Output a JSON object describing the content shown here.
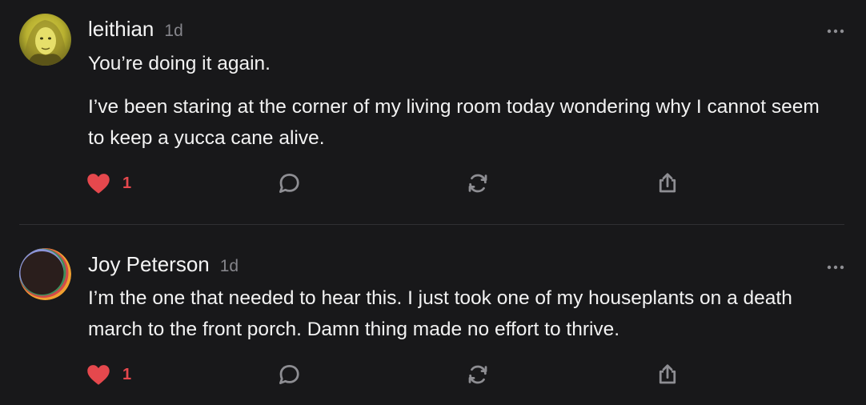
{
  "posts": [
    {
      "author": "leithian",
      "time": "1d",
      "paragraphs": [
        "You’re doing it again.",
        "I’ve been staring at the corner of my living room today wondering why I cannot seem to keep a yucca cane alive."
      ],
      "like_count": "1"
    },
    {
      "author": "Joy Peterson",
      "time": "1d",
      "paragraphs": [
        "I’m the one that needed to hear this. I just took one of my houseplants on a death march to the front porch. Damn thing made no effort to thrive."
      ],
      "like_count": "1"
    }
  ],
  "colors": {
    "background": "#18181a",
    "like": "#e5484d",
    "muted": "#85858b",
    "divider": "#2f2f33"
  },
  "icons": {
    "more": "more-icon",
    "like": "heart-icon",
    "reply": "reply-icon",
    "repost": "repost-icon",
    "share": "share-icon"
  }
}
